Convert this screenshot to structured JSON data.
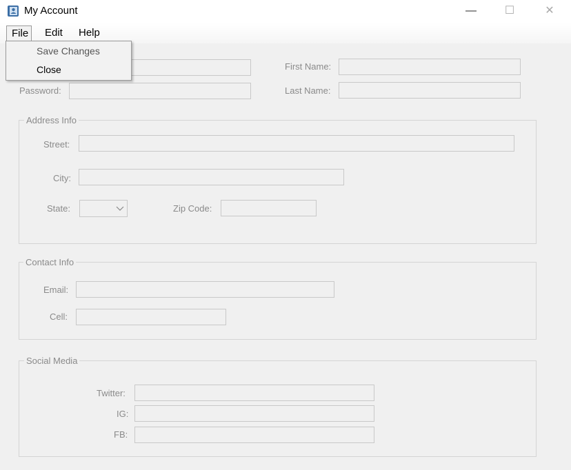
{
  "window": {
    "title": "My Account",
    "minimize_glyph": "—",
    "maximize_glyph": "☐",
    "close_glyph": "✕"
  },
  "menubar": {
    "items": [
      {
        "label": "File"
      },
      {
        "label": "Edit"
      },
      {
        "label": "Help"
      }
    ]
  },
  "file_menu": {
    "items": [
      {
        "label": "Save Changes"
      },
      {
        "label": "Close"
      }
    ]
  },
  "account": {
    "password_label": "Password:",
    "first_name_label": "First Name:",
    "last_name_label": "Last Name:"
  },
  "address": {
    "title": "Address Info",
    "street_label": "Street:",
    "city_label": "City:",
    "state_label": "State:",
    "zip_label": "Zip Code:"
  },
  "contact": {
    "title": "Contact Info",
    "email_label": "Email:",
    "cell_label": "Cell:"
  },
  "social": {
    "title": "Social Media",
    "twitter_label": "Twitter:",
    "ig_label": "IG:",
    "fb_label": "FB:"
  }
}
